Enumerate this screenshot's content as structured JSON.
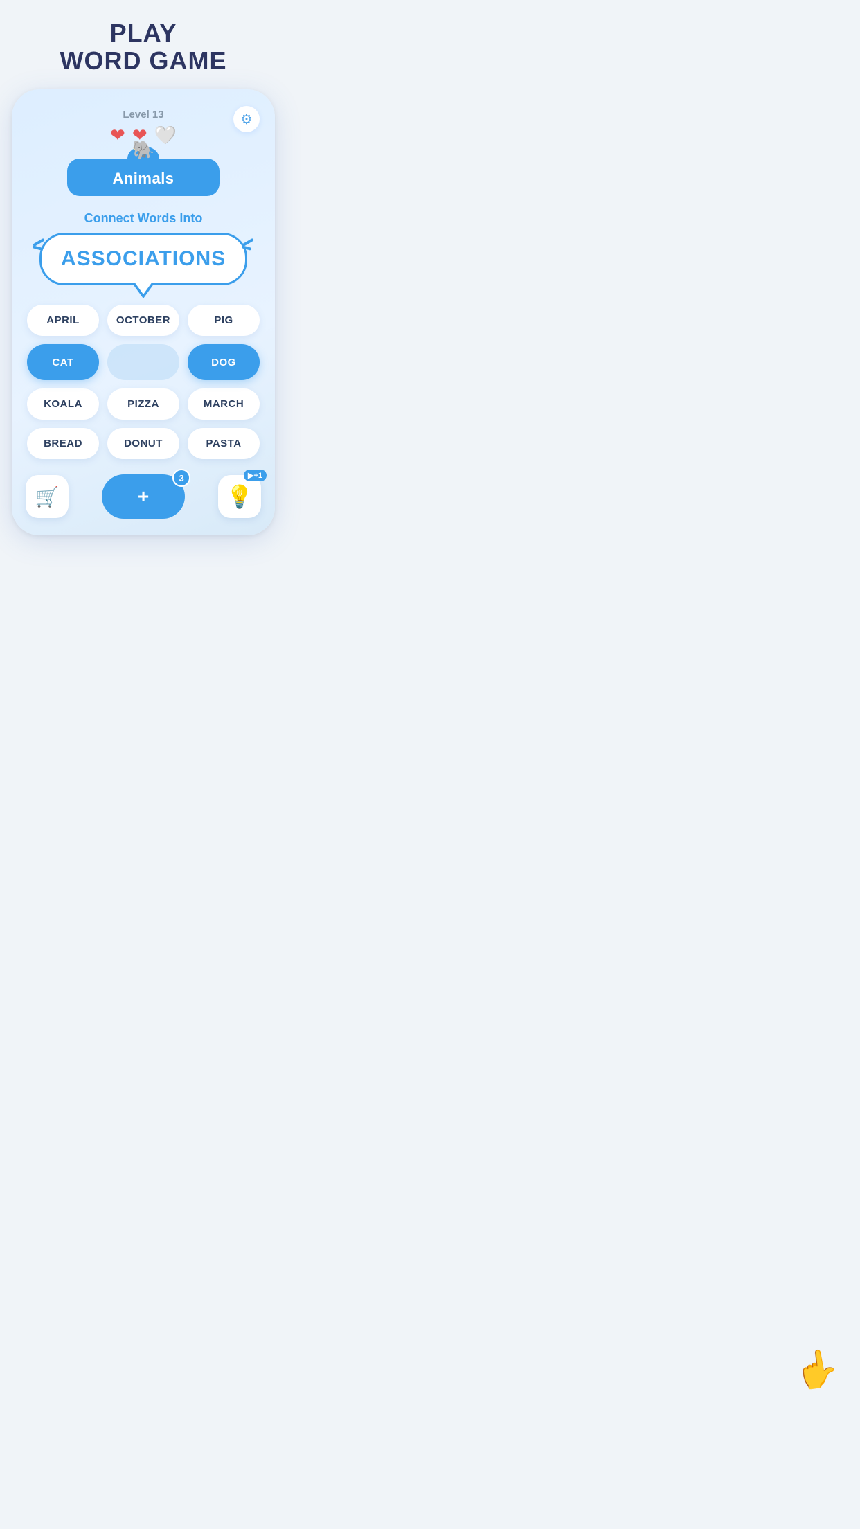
{
  "page": {
    "title_line1": "PLAY",
    "title_line2": "WORD GAME"
  },
  "game": {
    "level_label": "Level 13",
    "hearts": [
      {
        "filled": true
      },
      {
        "filled": true
      },
      {
        "filled": false
      }
    ],
    "settings_icon": "⚙",
    "category": {
      "icon": "🐘",
      "name": "Animals"
    },
    "connect_text": "Connect Words Into",
    "main_word": "ASSOCIATIONS",
    "words": [
      {
        "label": "APRIL",
        "selected": false,
        "row": 1,
        "col": 1
      },
      {
        "label": "OCTOBER",
        "selected": false,
        "row": 1,
        "col": 2
      },
      {
        "label": "PIG",
        "selected": false,
        "row": 1,
        "col": 3
      },
      {
        "label": "CAT",
        "selected": true,
        "row": 2,
        "col": 1
      },
      {
        "label": "",
        "selected": false,
        "row": 2,
        "col": 2,
        "hidden": true
      },
      {
        "label": "DOG",
        "selected": true,
        "row": 2,
        "col": 3
      },
      {
        "label": "KOALA",
        "selected": false,
        "row": 3,
        "col": 1
      },
      {
        "label": "PIZZA",
        "selected": false,
        "row": 3,
        "col": 2
      },
      {
        "label": "MARCH",
        "selected": false,
        "row": 3,
        "col": 3
      },
      {
        "label": "BREAD",
        "selected": false,
        "row": 4,
        "col": 1
      },
      {
        "label": "DONUT",
        "selected": false,
        "row": 4,
        "col": 2
      },
      {
        "label": "PASTA",
        "selected": false,
        "row": 4,
        "col": 3
      }
    ],
    "bottom": {
      "shop_icon": "🛒",
      "add_label": "+",
      "add_count": "3",
      "hint_icon": "💡",
      "hint_badge": "▶+1"
    }
  }
}
